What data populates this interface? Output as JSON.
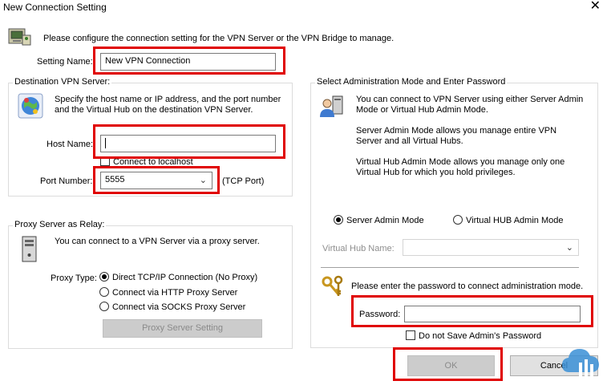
{
  "window": {
    "title": "New Connection Setting",
    "close_glyph": "✕"
  },
  "intro": "Please configure the connection setting for the VPN Server or the VPN Bridge to manage.",
  "setting_name": {
    "label": "Setting Name:",
    "value": "New VPN Connection"
  },
  "destination": {
    "legend": "Destination VPN Server:",
    "description_line1": "Specify the host name or IP address, and the port number",
    "description_line2": "and the Virtual Hub on the destination VPN Server.",
    "host_label": "Host Name:",
    "host_value": "",
    "localhost_label": "Connect to localhost",
    "port_label": "Port Number:",
    "port_value": "5555",
    "port_suffix": "(TCP Port)"
  },
  "proxy": {
    "legend": "Proxy Server as Relay:",
    "description": "You can connect to a VPN Server via a proxy server.",
    "type_label": "Proxy Type:",
    "options": [
      "Direct TCP/IP Connection (No Proxy)",
      "Connect via HTTP Proxy Server",
      "Connect via SOCKS Proxy Server"
    ],
    "selected": 0,
    "setting_button": "Proxy Server Setting"
  },
  "admin": {
    "legend": "Select Administration Mode and Enter Password",
    "para1_line1": "You can connect to VPN Server using either Server Admin",
    "para1_line2": "Mode or Virtual Hub Admin Mode.",
    "para2_line1": "Server Admin Mode allows you manage entire VPN",
    "para2_line2": "Server and all Virtual Hubs.",
    "para3_line1": "Virtual Hub Admin Mode allows you manage only one",
    "para3_line2": "Virtual Hub for which you hold privileges.",
    "mode_server": "Server Admin Mode",
    "mode_hub": "Virtual HUB Admin Mode",
    "hub_name_label": "Virtual Hub Name:",
    "password_prompt": "Please enter the password to connect administration mode.",
    "password_label": "Password:",
    "password_value": "",
    "no_save_label": "Do not Save Admin's Password"
  },
  "buttons": {
    "ok": "OK",
    "cancel": "Cancel"
  },
  "colors": {
    "highlight": "#e00000",
    "watermark": "#3a8fd6"
  },
  "icons": {
    "header": "network-settings-icon",
    "server": "vpn-server-globe-icon",
    "proxy": "computer-tower-icon",
    "admin": "admin-user-icon",
    "keys": "keys-icon",
    "watermark": "cloud-logo-icon"
  }
}
